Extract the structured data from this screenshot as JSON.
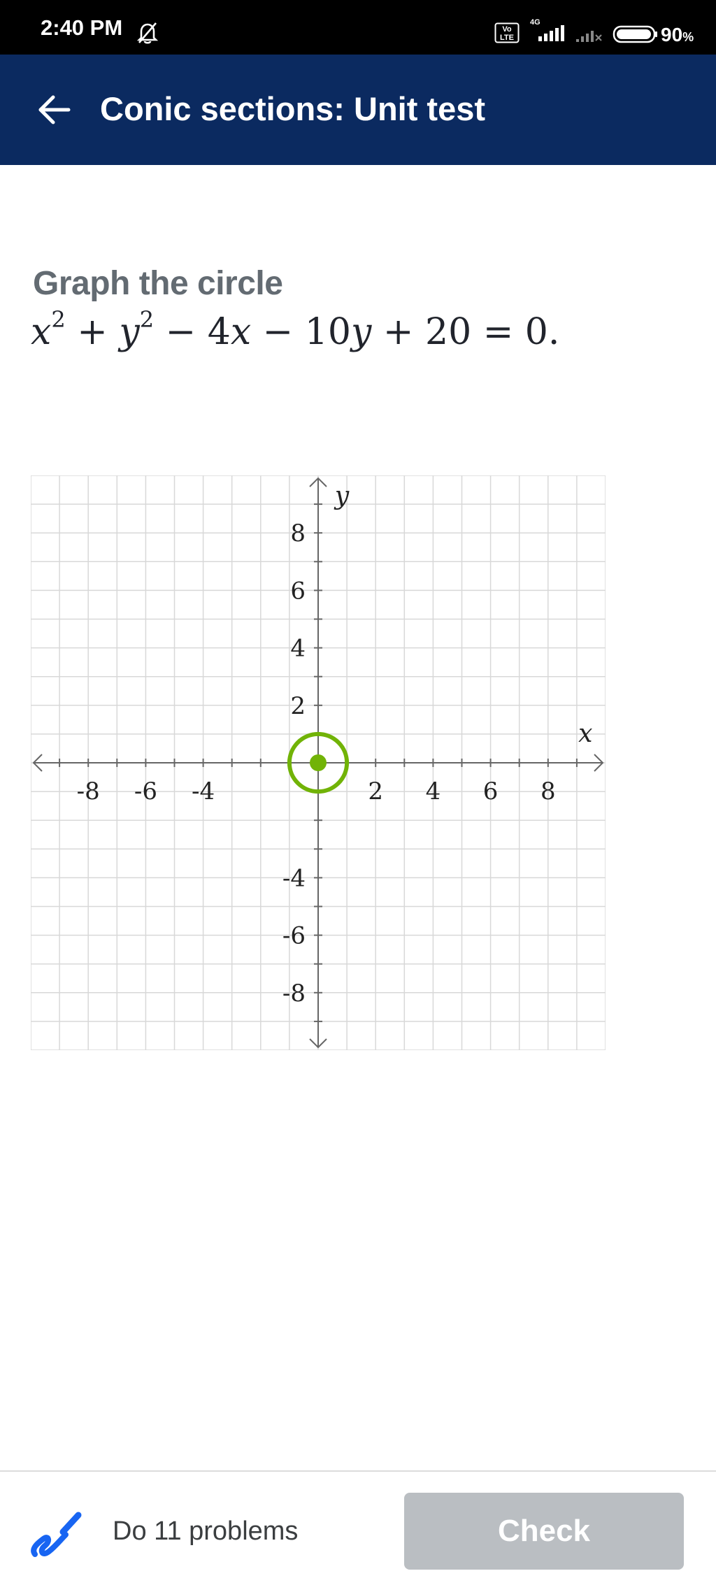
{
  "status_bar": {
    "time": "2:40 PM",
    "volte_top": "Vo",
    "volte_bottom": "LTE",
    "network": "4G",
    "battery": "90",
    "battery_unit": "%",
    "icons": [
      "bell-off-icon",
      "volte-icon",
      "signal-icon",
      "signal-no-service-icon",
      "battery-icon"
    ]
  },
  "header": {
    "back_icon": "arrow-left-icon",
    "title": "Conic sections: Unit test"
  },
  "question": {
    "prompt": "Graph the circle",
    "equation": {
      "x": "x",
      "sq": "2",
      "plus": "+",
      "y": "y",
      "minus": "−",
      "four": "4",
      "ten": "10",
      "twenty": "20",
      "equals": "=",
      "zero": "0."
    }
  },
  "graph": {
    "x_label": "x",
    "y_label": "y",
    "x_range": [
      -10,
      10
    ],
    "y_range": [
      -10,
      10
    ],
    "grid": true,
    "x_tick_labels": [
      {
        "value": -8,
        "text": "-8"
      },
      {
        "value": -6,
        "text": "-6"
      },
      {
        "value": -4,
        "text": "-4"
      },
      {
        "value": 2,
        "text": "2"
      },
      {
        "value": 4,
        "text": "4"
      },
      {
        "value": 6,
        "text": "6"
      },
      {
        "value": 8,
        "text": "8"
      }
    ],
    "y_tick_labels": [
      {
        "value": 8,
        "text": "8"
      },
      {
        "value": 6,
        "text": "6"
      },
      {
        "value": 4,
        "text": "4"
      },
      {
        "value": 2,
        "text": "2"
      },
      {
        "value": -4,
        "text": "-4"
      },
      {
        "value": -6,
        "text": "-6"
      },
      {
        "value": -8,
        "text": "-8"
      }
    ],
    "circle": {
      "center": [
        0,
        0
      ],
      "radius": 1,
      "color": "#71b307"
    },
    "axis_color": "#666666",
    "grid_color": "#d8d8d8"
  },
  "footer": {
    "scratchpad_icon": "scratchpad-icon",
    "problems_text": "Do 11 problems",
    "check_label": "Check"
  },
  "colors": {
    "header_bg": "#0b2a60",
    "check_bg": "#babec2",
    "accent_blue": "#1865f2",
    "graph_green": "#71b307"
  }
}
